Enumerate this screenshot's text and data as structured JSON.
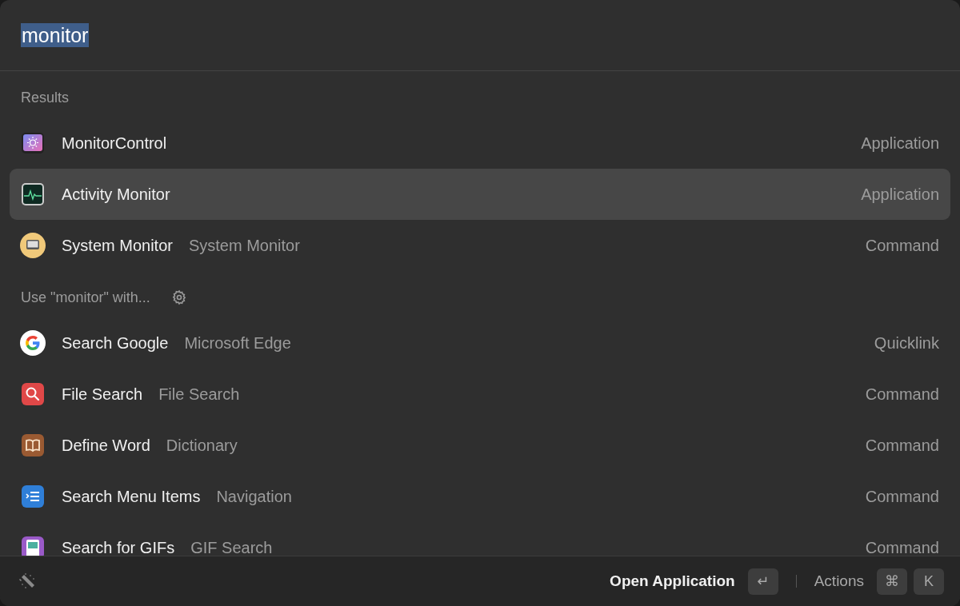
{
  "search": {
    "value": "monitor",
    "selected": true
  },
  "sections": [
    {
      "title": "Results",
      "settings_icon": false,
      "items": [
        {
          "kind": "monitorcontrol",
          "title": "MonitorControl",
          "type": "Application",
          "selected": false
        },
        {
          "kind": "activity",
          "title": "Activity Monitor",
          "type": "Application",
          "selected": true
        },
        {
          "kind": "systemmonitor",
          "title": "System Monitor",
          "subtitle": "System Monitor",
          "type": "Command",
          "selected": false
        }
      ]
    },
    {
      "title": "Use \"monitor\" with...",
      "settings_icon": true,
      "items": [
        {
          "kind": "google",
          "title": "Search Google",
          "subtitle": "Microsoft Edge",
          "type": "Quicklink",
          "selected": false
        },
        {
          "kind": "filesearch",
          "title": "File Search",
          "subtitle": "File Search",
          "type": "Command",
          "selected": false
        },
        {
          "kind": "dictionary",
          "title": "Define Word",
          "subtitle": "Dictionary",
          "type": "Command",
          "selected": false
        },
        {
          "kind": "menu",
          "title": "Search Menu Items",
          "subtitle": "Navigation",
          "type": "Command",
          "selected": false
        },
        {
          "kind": "gif",
          "title": "Search for GIFs",
          "subtitle": "GIF Search",
          "type": "Command",
          "selected": false
        }
      ]
    }
  ],
  "footer": {
    "primary_action": "Open Application",
    "primary_keys": [
      "↵"
    ],
    "secondary_action": "Actions",
    "secondary_keys": [
      "⌘",
      "K"
    ]
  }
}
